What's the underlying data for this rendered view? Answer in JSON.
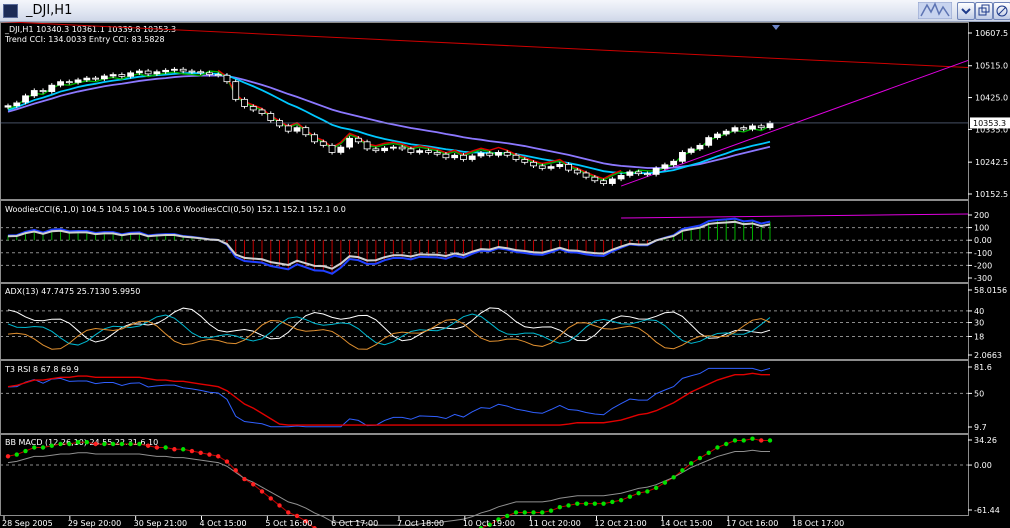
{
  "window": {
    "title": "_DJI,H1"
  },
  "colors": {
    "background": "#000000",
    "grid": "#8c8c8c",
    "text": "#ffffff",
    "bull": "#ffffff",
    "bear": "#000000",
    "ema_fast": "#00c8ff",
    "ema_slow": "#8c78ff",
    "stop_up": "#00b000",
    "stop_dn": "#e00000",
    "trend": "#e000e0",
    "channel": "#cc0000"
  },
  "header": {
    "line1": "_DJI,H1  10340.3 10361.1 10339.8 10353.3",
    "line2": "Trend CCI: 134.0033 Entry CCI: 83.5828"
  },
  "price_axis": {
    "ticks": [
      "10607.5",
      "10515.0",
      "10425.0",
      "10335.0",
      "10242.5",
      "10152.5"
    ],
    "current": "10353.3"
  },
  "panels": [
    {
      "id": "woodies",
      "label": "WoodiesCCI(6,1,0) 104.5 104.5 104.5 100.6  WoodiesCCI(0,50) 152.1 152.1 152.1 0.0",
      "ticks": [
        "200",
        "100",
        "0.00",
        "-100",
        "-200",
        "-300"
      ],
      "levels": [
        100,
        -100
      ]
    },
    {
      "id": "adx",
      "label": "ADX(13) 47.7475 25.7130 5.9950",
      "ticks": [
        "58.0156",
        "40",
        "30",
        "18",
        "2.0663"
      ]
    },
    {
      "id": "rsi",
      "label": "T3 RSI 8 67.8 69.9",
      "ticks": [
        "81.6",
        "50",
        "9.7"
      ]
    },
    {
      "id": "macd",
      "label": "BB MACD (12,26,10) 24.55 22.31 6.10",
      "ticks": [
        "34.26",
        "0.00",
        "-61.44"
      ]
    }
  ],
  "time_axis": [
    "28 Sep 2005",
    "29 Sep 20:00",
    "30 Sep 21:00",
    "4 Oct 15:00",
    "5 Oct 16:00",
    "6 Oct 17:00",
    "7 Oct 18:00",
    "10 Oct 19:00",
    "11 Oct 20:00",
    "12 Oct 21:00",
    "14 Oct 15:00",
    "17 Oct 16:00",
    "18 Oct 17:00"
  ],
  "chart_data": {
    "type": "candlestick",
    "symbol": "_DJI",
    "timeframe": "H1",
    "ylim": [
      10152.5,
      10607.5
    ],
    "close": [
      10402,
      10410,
      10430,
      10445,
      10442,
      10460,
      10470,
      10468,
      10475,
      10480,
      10478,
      10486,
      10490,
      10485,
      10495,
      10500,
      10492,
      10498,
      10502,
      10505,
      10500,
      10498,
      10495,
      10490,
      10488,
      10470,
      10420,
      10400,
      10390,
      10380,
      10360,
      10345,
      10330,
      10340,
      10320,
      10300,
      10290,
      10270,
      10285,
      10310,
      10300,
      10280,
      10275,
      10282,
      10285,
      10280,
      10270,
      10275,
      10270,
      10265,
      10255,
      10262,
      10250,
      10260,
      10268,
      10262,
      10270,
      10262,
      10250,
      10242,
      10232,
      10225,
      10230,
      10236,
      10220,
      10212,
      10200,
      10190,
      10182,
      10195,
      10205,
      10215,
      10210,
      10208,
      10225,
      10235,
      10245,
      10270,
      10280,
      10290,
      10312,
      10322,
      10330,
      10340,
      10336,
      10345,
      10340,
      10353
    ],
    "open": [
      10398,
      10402,
      10412,
      10430,
      10445,
      10442,
      10460,
      10470,
      10468,
      10475,
      10480,
      10478,
      10486,
      10490,
      10485,
      10495,
      10500,
      10492,
      10498,
      10502,
      10505,
      10500,
      10498,
      10495,
      10490,
      10488,
      10470,
      10420,
      10400,
      10390,
      10380,
      10360,
      10345,
      10330,
      10340,
      10320,
      10300,
      10290,
      10270,
      10285,
      10310,
      10300,
      10280,
      10275,
      10282,
      10285,
      10280,
      10270,
      10275,
      10270,
      10265,
      10255,
      10262,
      10250,
      10260,
      10268,
      10262,
      10270,
      10262,
      10250,
      10242,
      10232,
      10225,
      10230,
      10236,
      10220,
      10212,
      10200,
      10190,
      10182,
      10195,
      10205,
      10215,
      10210,
      10208,
      10225,
      10235,
      10245,
      10270,
      10280,
      10290,
      10312,
      10322,
      10330,
      10340,
      10336,
      10345,
      10340
    ],
    "ema_fast": [
      10390,
      10398,
      10408,
      10418,
      10425,
      10433,
      10442,
      10448,
      10455,
      10460,
      10464,
      10469,
      10473,
      10476,
      10480,
      10484,
      10486,
      10488,
      10490,
      10492,
      10494,
      10494,
      10494,
      10493,
      10492,
      10488,
      10478,
      10467,
      10457,
      10446,
      10434,
      10421,
      10408,
      10398,
      10386,
      10373,
      10361,
      10348,
      10340,
      10335,
      10329,
      10321,
      10314,
      10308,
      10303,
      10298,
      10293,
      10290,
      10287,
      10283,
      10279,
      10276,
      10272,
      10270,
      10270,
      10268,
      10268,
      10267,
      10265,
      10261,
      10256,
      10251,
      10247,
      10244,
      10240,
      10235,
      10229,
      10223,
      10217,
      10214,
      10212,
      10212,
      10212,
      10211,
      10213,
      10216,
      10220,
      10227,
      10234,
      10241,
      10250,
      10259,
      10267,
      10276,
      10282,
      10289,
      10294,
      10300
    ],
    "ema_slow": [
      10385,
      10392,
      10400,
      10408,
      10415,
      10422,
      10430,
      10436,
      10442,
      10447,
      10452,
      10457,
      10461,
      10464,
      10468,
      10472,
      10475,
      10478,
      10480,
      10483,
      10485,
      10486,
      10487,
      10487,
      10487,
      10486,
      10481,
      10475,
      10468,
      10461,
      10453,
      10444,
      10435,
      10427,
      10418,
      10409,
      10400,
      10391,
      10384,
      10378,
      10372,
      10366,
      10360,
      10354,
      10349,
      10344,
      10339,
      10335,
      10331,
      10327,
      10322,
      10318,
      10313,
      10309,
      10306,
      10302,
      10299,
      10296,
      10292,
      10288,
      10283,
      10278,
      10273,
      10268,
      10263,
      10257,
      10251,
      10245,
      10239,
      10235,
      10232,
      10230,
      10228,
      10226,
      10226,
      10226,
      10227,
      10230,
      10233,
      10237,
      10243,
      10249,
      10255,
      10262,
      10268,
      10274,
      10280,
      10286
    ]
  }
}
